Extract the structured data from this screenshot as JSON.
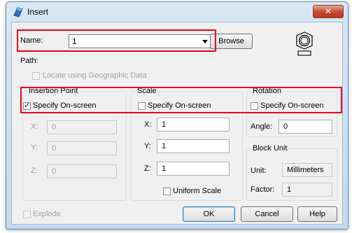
{
  "window": {
    "title": "Insert",
    "close_label": "✕"
  },
  "name_row": {
    "label": "Name:",
    "value": "1",
    "browse_label": "Browse"
  },
  "path": {
    "label": "Path:"
  },
  "geo": {
    "label": "Locate using Geographic Data",
    "checked": false
  },
  "insertion_point": {
    "title": "Insertion Point",
    "specify_label": "Specify On-screen",
    "specify_checked": true,
    "x_label": "X:",
    "x_value": "0",
    "y_label": "Y:",
    "y_value": "0",
    "z_label": "Z:",
    "z_value": "0"
  },
  "scale": {
    "title": "Scale",
    "specify_label": "Specify On-screen",
    "specify_checked": false,
    "x_label": "X:",
    "x_value": "1",
    "y_label": "Y:",
    "y_value": "1",
    "z_label": "Z:",
    "z_value": "1",
    "uniform_label": "Uniform Scale",
    "uniform_checked": false
  },
  "rotation": {
    "title": "Rotation",
    "specify_label": "Specify On-screen",
    "specify_checked": false,
    "angle_label": "Angle:",
    "angle_value": "0"
  },
  "block_unit": {
    "title": "Block Unit",
    "unit_label": "Unit:",
    "unit_value": "Millimeters",
    "factor_label": "Factor:",
    "factor_value": "1"
  },
  "explode": {
    "label": "Explode",
    "checked": false
  },
  "buttons": {
    "ok": "OK",
    "cancel": "Cancel",
    "help": "Help"
  },
  "colors": {
    "highlight": "#e8001c",
    "titlebar": "#c5d9ee"
  }
}
